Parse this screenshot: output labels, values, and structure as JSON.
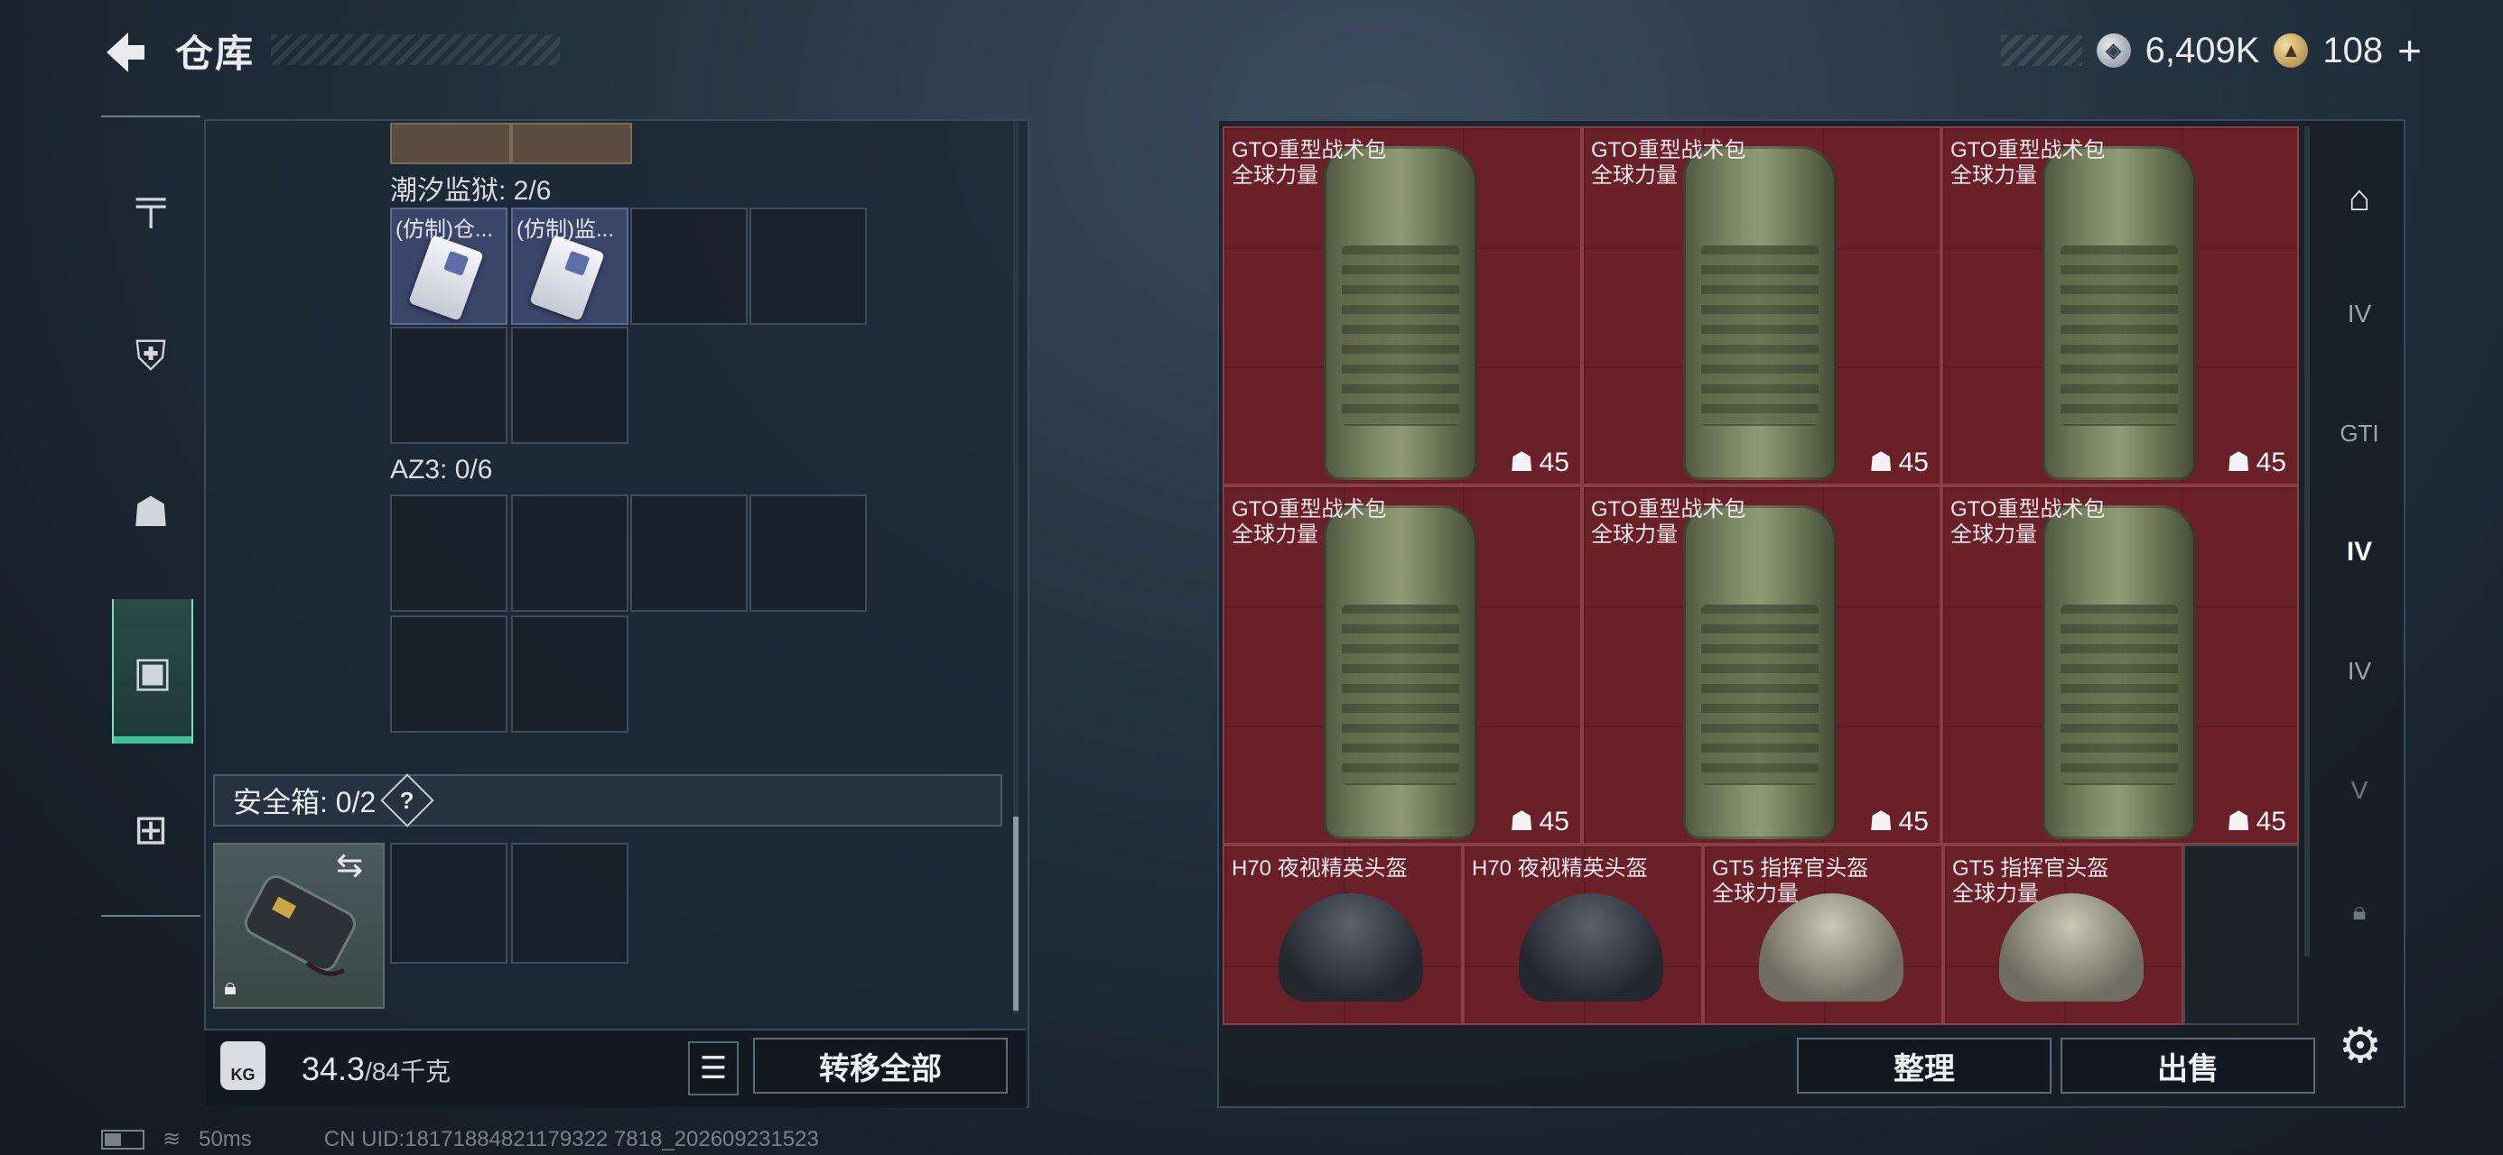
{
  "header": {
    "back_icon": "chevron-left-icon",
    "title": "仓库",
    "currency_silver": "6,409K",
    "currency_gold": "108",
    "currency_add": "+"
  },
  "left_nav": {
    "items": [
      {
        "icon": "pistol-icon"
      },
      {
        "icon": "armor-vest-icon"
      },
      {
        "icon": "backpack-icon"
      },
      {
        "icon": "case-icon",
        "active": true
      },
      {
        "icon": "toolbox-icon"
      }
    ]
  },
  "container": {
    "sections": [
      {
        "label": "潮汐监狱: 2/6",
        "items": [
          "(仿制)仓...",
          "(仿制)监..."
        ]
      },
      {
        "label": "AZ3: 0/6",
        "items": []
      }
    ],
    "safe_box": {
      "label": "安全箱: 0/2",
      "help": "?"
    },
    "weight": {
      "icon_text": "KG",
      "current": "34.3",
      "max": "/84千克"
    },
    "transfer_all": "转移全部"
  },
  "stash": {
    "items": [
      {
        "name": "GTO重型战术包",
        "sub": "全球力量",
        "count": "45"
      },
      {
        "name": "GTO重型战术包",
        "sub": "全球力量",
        "count": "45"
      },
      {
        "name": "GTO重型战术包",
        "sub": "全球力量",
        "count": "45"
      },
      {
        "name": "GTO重型战术包",
        "sub": "全球力量",
        "count": "45"
      },
      {
        "name": "GTO重型战术包",
        "sub": "全球力量",
        "count": "45"
      },
      {
        "name": "GTO重型战术包",
        "sub": "全球力量",
        "count": "45"
      },
      {
        "name": "H70 夜视精英头盔",
        "sub": ""
      },
      {
        "name": "H70 夜视精英头盔",
        "sub": ""
      },
      {
        "name": "GT5 指挥官头盔",
        "sub": "全球力量"
      },
      {
        "name": "GT5 指挥官头盔",
        "sub": "全球力量"
      }
    ],
    "sort_button": "整理",
    "sell_button": "出售"
  },
  "right_nav": {
    "items": [
      {
        "icon": "archway-icon",
        "label": ""
      },
      {
        "icon": "tier-iv-icon",
        "label": "IV"
      },
      {
        "icon": "gti-icon",
        "label": "GTI"
      },
      {
        "icon": "tier-iv-active-icon",
        "label": "IV"
      },
      {
        "icon": "tier-iv-add-icon",
        "label": "IV"
      },
      {
        "icon": "tier-v-icon",
        "label": "V"
      },
      {
        "icon": "lock-icon",
        "label": ""
      }
    ]
  },
  "status": {
    "ping": "50ms",
    "uid": "CN UID:18171884821179322 7818_202609231523"
  }
}
